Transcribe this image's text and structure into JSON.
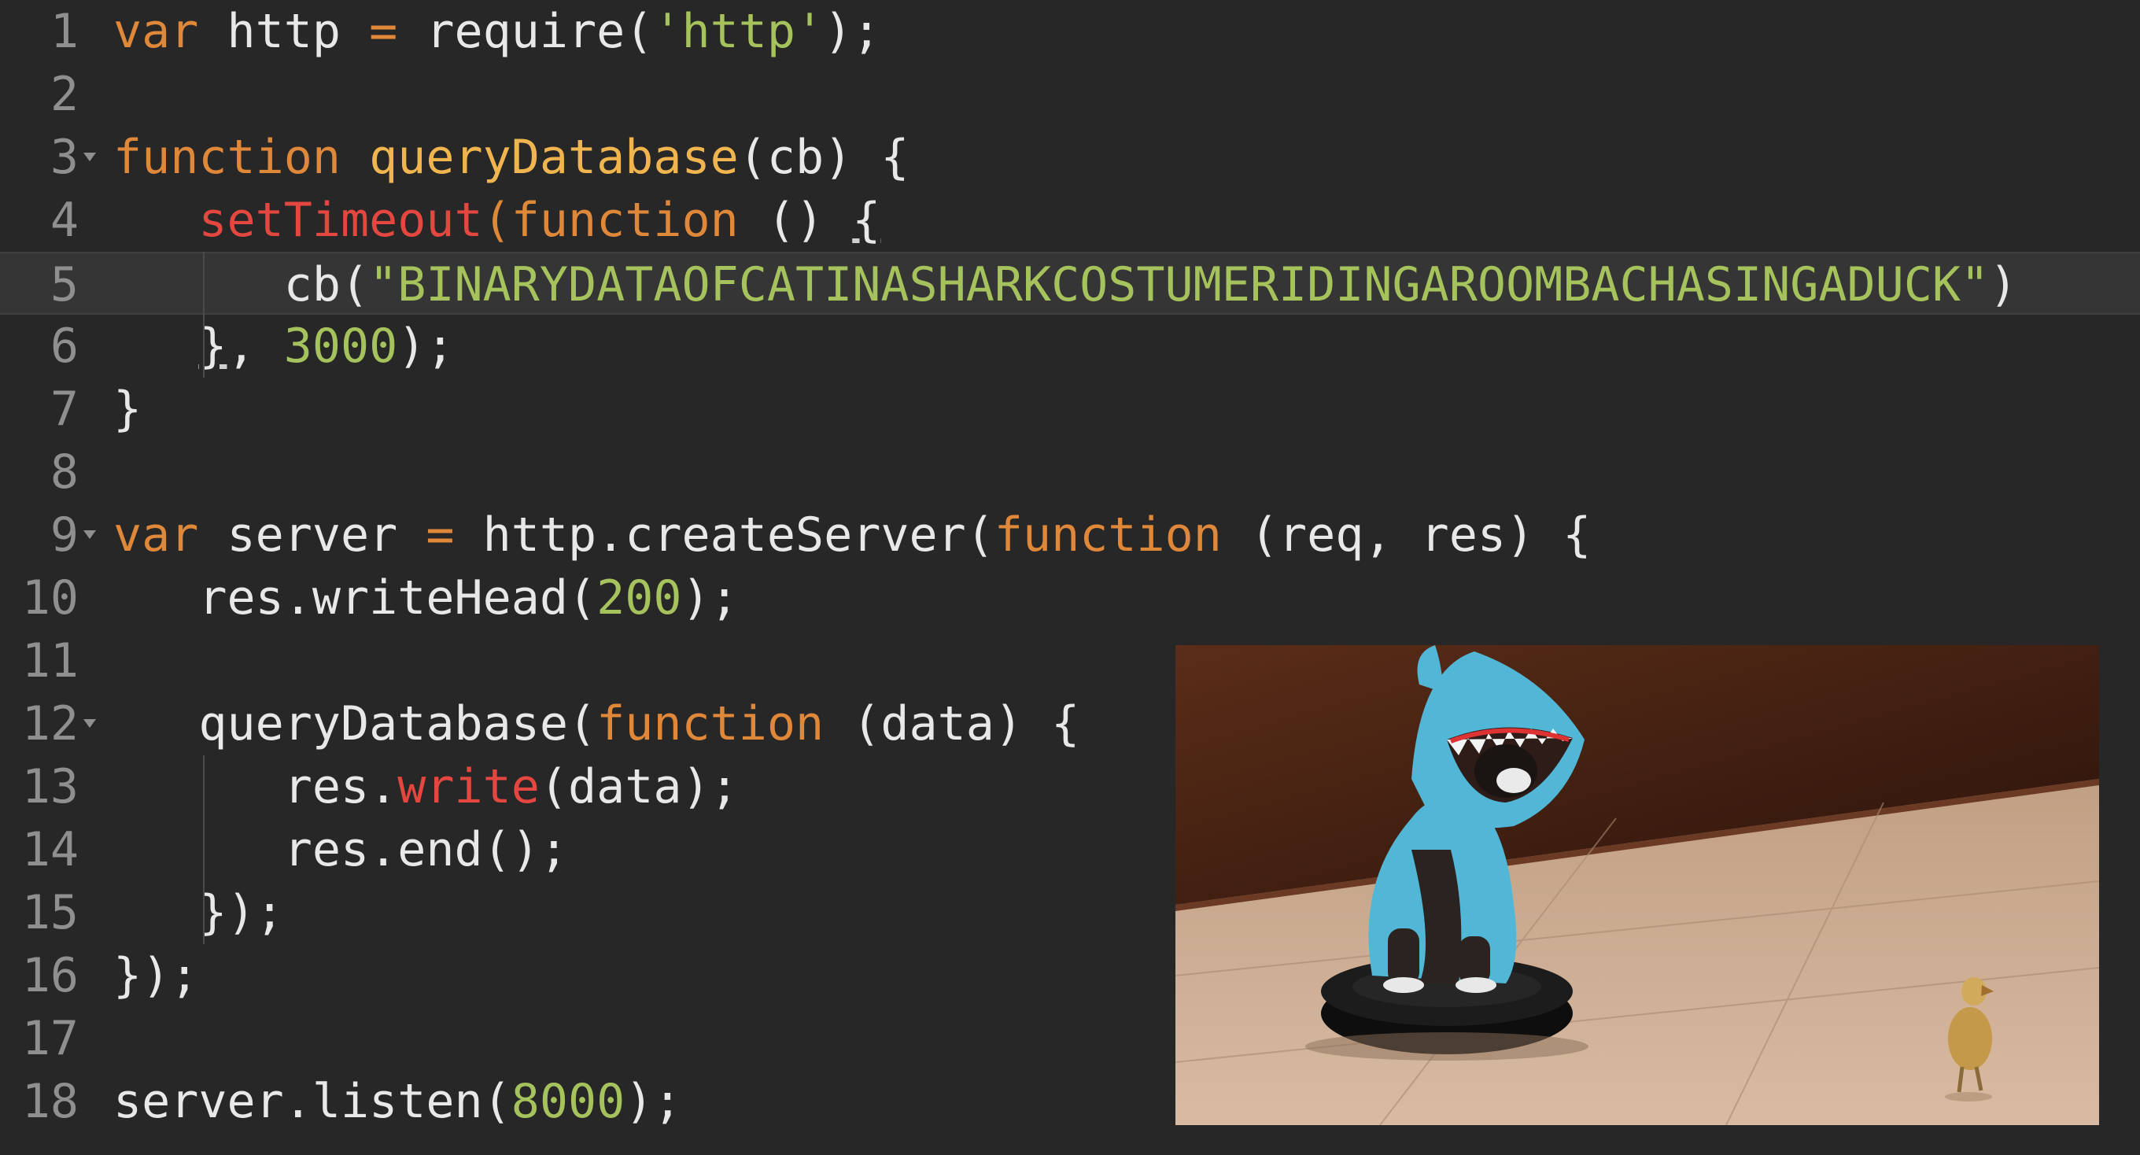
{
  "lines": [
    {
      "num": "1",
      "t": [
        [
          "kw",
          "var"
        ],
        [
          "p",
          " http "
        ],
        [
          "kw",
          "="
        ],
        [
          "p",
          " require("
        ],
        [
          "st",
          "'http'"
        ],
        [
          "p",
          ");"
        ]
      ]
    },
    {
      "num": "2",
      "t": []
    },
    {
      "num": "3",
      "fold": true,
      "t": [
        [
          "kw",
          "function"
        ],
        [
          "p",
          " "
        ],
        [
          "fn",
          "queryDatabase"
        ],
        [
          "p",
          "(cb) {"
        ]
      ]
    },
    {
      "num": "4",
      "t": [
        [
          "p",
          "   "
        ],
        [
          "bi",
          "setTimeout"
        ],
        [
          "kw",
          "(function"
        ],
        [
          "p",
          " () "
        ],
        [
          "ul",
          "{"
        ]
      ]
    },
    {
      "num": "5",
      "active": true,
      "t": [
        [
          "p",
          "      cb("
        ],
        [
          "st",
          "\"BINARYDATAOFCATINASHARKCOSTUMERIDINGAROOMBACHASINGADUCK\""
        ],
        [
          "p",
          ")"
        ]
      ]
    },
    {
      "num": "6",
      "t": [
        [
          "p",
          "   "
        ],
        [
          "ul",
          "}"
        ],
        [
          "p",
          ", "
        ],
        [
          "nu",
          "3000"
        ],
        [
          "p",
          ");"
        ]
      ]
    },
    {
      "num": "7",
      "t": [
        [
          "p",
          "}"
        ]
      ]
    },
    {
      "num": "8",
      "t": []
    },
    {
      "num": "9",
      "fold": true,
      "t": [
        [
          "kw",
          "var"
        ],
        [
          "p",
          " server "
        ],
        [
          "kw",
          "="
        ],
        [
          "p",
          " http.createServer("
        ],
        [
          "kw",
          "function"
        ],
        [
          "p",
          " (req, res) {"
        ]
      ]
    },
    {
      "num": "10",
      "t": [
        [
          "p",
          "   res.writeHead("
        ],
        [
          "nu",
          "200"
        ],
        [
          "p",
          ");"
        ]
      ]
    },
    {
      "num": "11",
      "t": []
    },
    {
      "num": "12",
      "fold": true,
      "t": [
        [
          "p",
          "   queryDatabase("
        ],
        [
          "kw",
          "function"
        ],
        [
          "p",
          " (data) {"
        ]
      ]
    },
    {
      "num": "13",
      "t": [
        [
          "p",
          "      res."
        ],
        [
          "bi",
          "write"
        ],
        [
          "p",
          "(data);"
        ]
      ]
    },
    {
      "num": "14",
      "t": [
        [
          "p",
          "      res.end();"
        ]
      ]
    },
    {
      "num": "15",
      "t": [
        [
          "p",
          "   });"
        ]
      ]
    },
    {
      "num": "16",
      "t": [
        [
          "p",
          "});"
        ]
      ]
    },
    {
      "num": "17",
      "t": []
    },
    {
      "num": "18",
      "t": [
        [
          "p",
          "server.listen("
        ],
        [
          "nu",
          "8000"
        ],
        [
          "p",
          ");"
        ]
      ]
    }
  ],
  "photo": {
    "subject": "cat-in-shark-costume-on-roomba-chasing-duckling",
    "colors": {
      "costume": "#52b7d6",
      "floor": "#c8a88c",
      "wall": "#3a1b10",
      "roomba": "#141414",
      "duck": "#c49a4a"
    }
  },
  "colors": {
    "background": "#272727",
    "keyword": "#e0883a",
    "function": "#f0b54f",
    "builtin": "#e3473f",
    "string": "#a5c25c",
    "text": "#e8e8e8",
    "gutter": "#8f8f8f"
  }
}
